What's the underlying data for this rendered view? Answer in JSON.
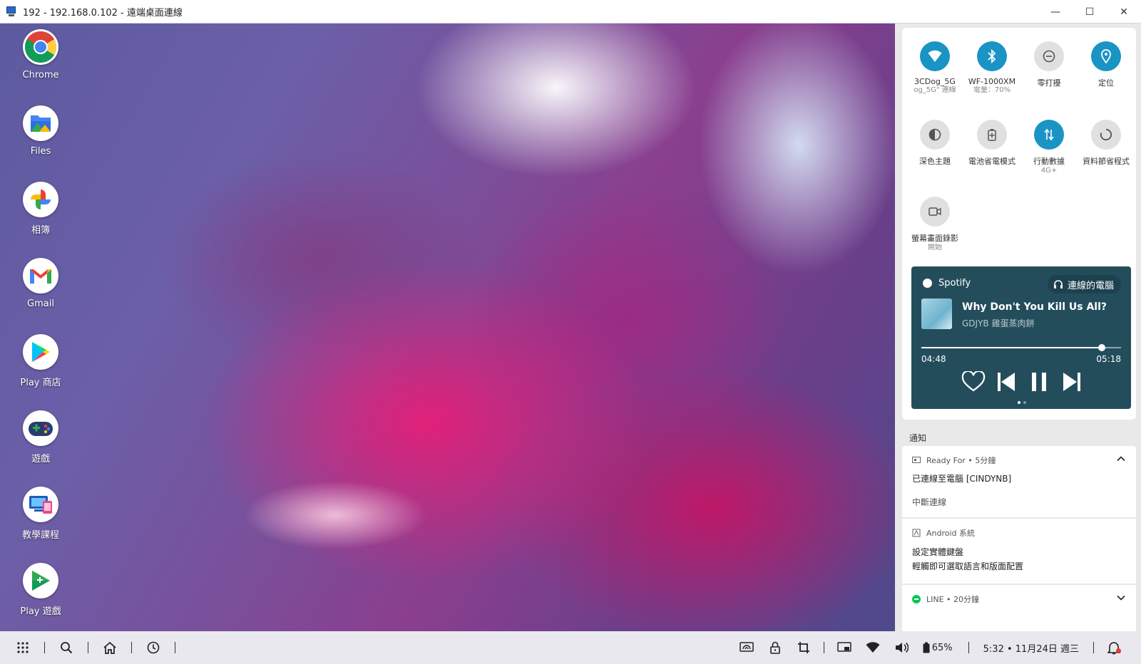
{
  "window": {
    "title": "192 - 192.168.0.102 - 遠端桌面連線",
    "minimize": "—",
    "maximize": "☐",
    "close": "✕"
  },
  "desktop_apps": [
    {
      "label": "Chrome",
      "icon": "chrome-icon"
    },
    {
      "label": "Files",
      "icon": "files-icon"
    },
    {
      "label": "相簿",
      "icon": "photos-icon"
    },
    {
      "label": "Gmail",
      "icon": "gmail-icon"
    },
    {
      "label": "Play 商店",
      "icon": "play-store-icon"
    },
    {
      "label": "遊戲",
      "icon": "games-icon"
    },
    {
      "label": "教學課程",
      "icon": "tutorial-icon"
    },
    {
      "label": "Play 遊戲",
      "icon": "play-games-icon"
    }
  ],
  "quick_settings": [
    {
      "label": "3CDog_5G",
      "sub": "og_5G\" 連線",
      "state": "on",
      "icon": "wifi-icon"
    },
    {
      "label": "WF-1000XM",
      "sub": "電量：70%",
      "state": "on",
      "icon": "bluetooth-icon"
    },
    {
      "label": "零打擾",
      "sub": "",
      "state": "off",
      "icon": "do-not-disturb-icon"
    },
    {
      "label": "定位",
      "sub": "",
      "state": "on",
      "icon": "location-icon"
    },
    {
      "label": "深色主題",
      "sub": "",
      "state": "off",
      "icon": "dark-theme-icon"
    },
    {
      "label": "電池省電模式",
      "sub": "",
      "state": "off",
      "icon": "battery-saver-icon"
    },
    {
      "label": "行動數據",
      "sub": "4G+",
      "state": "on",
      "icon": "mobile-data-icon"
    },
    {
      "label": "資料節省程式",
      "sub": "",
      "state": "off",
      "icon": "data-saver-icon"
    },
    {
      "label": "螢幕畫面錄影",
      "sub": "開始",
      "state": "off",
      "icon": "screen-record-icon"
    }
  ],
  "media": {
    "app": "Spotify",
    "output": "連線的電腦",
    "title": "Why Don't You Kill Us All?",
    "artist": "GDJYB 雞蛋蒸肉餅",
    "current_time": "04:48",
    "total_time": "05:18",
    "progress": 0.904
  },
  "notifications": {
    "header": "通知",
    "items": [
      {
        "app": "Ready For • 5分鐘",
        "title": "已連線至電腦 [CINDYNB]",
        "action": "中斷連線",
        "expanded": true
      },
      {
        "app": "Android 系統",
        "title": "設定實體鍵盤",
        "text": "輕觸即可選取語言和版面配置"
      },
      {
        "app": "LINE • 20分鐘",
        "expanded": false
      }
    ]
  },
  "taskbar": {
    "battery": "65%",
    "clock": "5:32 • 11月24日 週三"
  },
  "colors": {
    "accent": "#1a94c4",
    "media_bg": "#244d5c"
  }
}
